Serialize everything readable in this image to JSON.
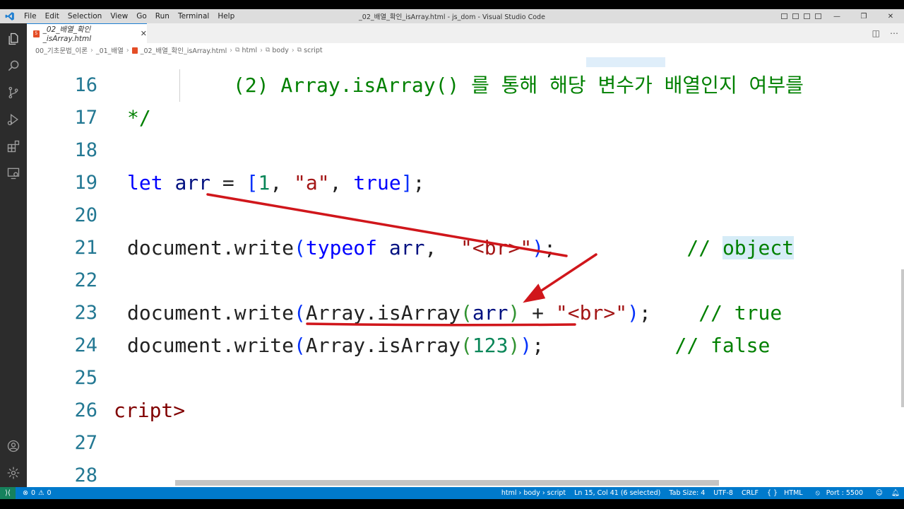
{
  "window": {
    "title": "_02_배열_확인_isArray.html - js_dom - Visual Studio Code",
    "menu": [
      "File",
      "Edit",
      "Selection",
      "View",
      "Go",
      "Run",
      "Terminal",
      "Help"
    ],
    "controls": {
      "minimize": "—",
      "restore": "❐",
      "close": "✕"
    }
  },
  "tab": {
    "label": "_02_배열_확인_isArray.html",
    "badge": "5"
  },
  "breadcrumb": [
    "00_기초문법_이론",
    "_01_배열",
    "_02_배열_확인_isArray.html",
    "html",
    "body",
    "script"
  ],
  "editor": {
    "lines": [
      {
        "num": "16",
        "tokens": [
          {
            "t": "(2) Array.isArray() 를 통해 해당 변수가 배열인지 여부를",
            "c": "c-com"
          }
        ]
      },
      {
        "num": "17",
        "tokens": [
          {
            "t": "*/",
            "c": "c-com"
          }
        ]
      },
      {
        "num": "18",
        "tokens": []
      },
      {
        "num": "19",
        "tokens": [
          {
            "t": "let",
            "c": "c-kw"
          },
          {
            "t": " ",
            "c": "c-plain"
          },
          {
            "t": "arr",
            "c": "c-var"
          },
          {
            "t": " = ",
            "c": "c-plain"
          },
          {
            "t": "[",
            "c": "c-b1"
          },
          {
            "t": "1",
            "c": "c-num"
          },
          {
            "t": ", ",
            "c": "c-plain"
          },
          {
            "t": "\"a\"",
            "c": "c-str"
          },
          {
            "t": ", ",
            "c": "c-plain"
          },
          {
            "t": "true",
            "c": "c-kw"
          },
          {
            "t": "]",
            "c": "c-b1"
          },
          {
            "t": ";",
            "c": "c-plain"
          }
        ]
      },
      {
        "num": "20",
        "tokens": []
      },
      {
        "num": "21",
        "tokens": [
          {
            "t": "document.write",
            "c": "c-plain"
          },
          {
            "t": "(",
            "c": "c-b1"
          },
          {
            "t": "typeof",
            "c": "c-kw"
          },
          {
            "t": " ",
            "c": "c-plain"
          },
          {
            "t": "arr",
            "c": "c-var"
          },
          {
            "t": ",  ",
            "c": "c-plain"
          },
          {
            "t": "\"<br>\"",
            "c": "c-str"
          },
          {
            "t": ")",
            "c": "c-b1"
          },
          {
            "t": ";",
            "c": "c-plain"
          },
          {
            "t": "           // ",
            "c": "c-com"
          },
          {
            "t": "object",
            "c": "c-com hl"
          }
        ]
      },
      {
        "num": "22",
        "tokens": []
      },
      {
        "num": "23",
        "tokens": [
          {
            "t": "document.write",
            "c": "c-plain"
          },
          {
            "t": "(",
            "c": "c-b1"
          },
          {
            "t": "Array.isArray",
            "c": "c-plain"
          },
          {
            "t": "(",
            "c": "c-b2"
          },
          {
            "t": "arr",
            "c": "c-var"
          },
          {
            "t": ")",
            "c": "c-b2"
          },
          {
            "t": " + ",
            "c": "c-plain"
          },
          {
            "t": "\"<br>\"",
            "c": "c-str"
          },
          {
            "t": ")",
            "c": "c-b1"
          },
          {
            "t": ";",
            "c": "c-plain"
          },
          {
            "t": "    // true",
            "c": "c-com"
          }
        ]
      },
      {
        "num": "24",
        "tokens": [
          {
            "t": "document.write",
            "c": "c-plain"
          },
          {
            "t": "(",
            "c": "c-b1"
          },
          {
            "t": "Array.isArray",
            "c": "c-plain"
          },
          {
            "t": "(",
            "c": "c-b2"
          },
          {
            "t": "123",
            "c": "c-num"
          },
          {
            "t": ")",
            "c": "c-b2"
          },
          {
            "t": ")",
            "c": "c-b1"
          },
          {
            "t": ";",
            "c": "c-plain"
          },
          {
            "t": "           // false",
            "c": "c-com"
          }
        ]
      },
      {
        "num": "25",
        "tokens": []
      },
      {
        "num": "26",
        "tokens": [
          {
            "t": "cript>",
            "c": "c-tag"
          }
        ]
      },
      {
        "num": "27",
        "tokens": []
      },
      {
        "num": "28",
        "tokens": []
      }
    ]
  },
  "status": {
    "errors": "0",
    "warnings": "0",
    "path": "html › body › script",
    "cursor": "Ln 15, Col 41 (6 selected)",
    "tab_size": "Tab Size: 4",
    "encoding": "UTF-8",
    "eol": "CRLF",
    "language": "HTML",
    "port": "Port : 5500"
  },
  "colors": {
    "statusbar": "#007acc",
    "remote": "#16825d",
    "activitybar": "#2c2c2c",
    "annotation": "#d0161b"
  },
  "icons": [
    "vscode-logo-icon",
    "explorer-icon",
    "search-icon",
    "source-control-icon",
    "run-debug-icon",
    "extensions-icon",
    "remote-explorer-icon",
    "account-icon",
    "gear-icon",
    "split-editor-icon",
    "more-actions-icon",
    "bell-icon"
  ]
}
